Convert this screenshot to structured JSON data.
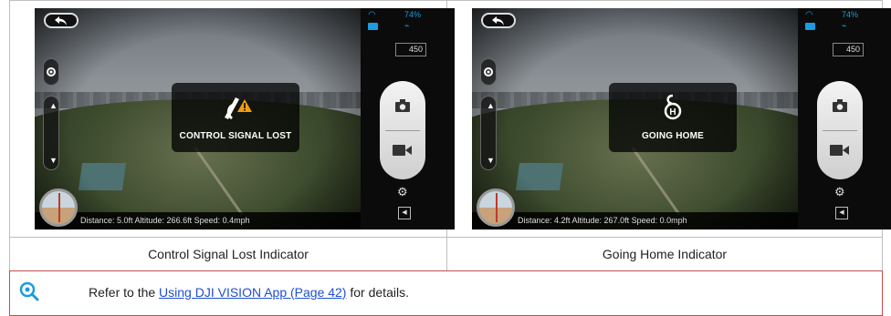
{
  "panels": [
    {
      "overlay_label": "CONTROL SIGNAL LOST",
      "overlay_icon": "signal-lost-warning-icon",
      "status": "Distance: 5.0ft  Altitude: 266.6ft  Speed: 0.4mph",
      "altitude_box": "450",
      "battery": "74%",
      "caption": "Control Signal Lost Indicator"
    },
    {
      "overlay_label": "GOING HOME",
      "overlay_icon": "home-point-icon",
      "status": "Distance: 4.2ft  Altitude: 267.0ft  Speed: 0.0mph",
      "altitude_box": "450",
      "battery": "74%",
      "caption": "Going Home Indicator"
    }
  ],
  "note": {
    "prefix": "Refer to the ",
    "link": "Using DJI VISION App (Page 42)",
    "suffix": " for details.",
    "icon": "magnifier-icon"
  },
  "colors": {
    "accent": "#1e9bdc",
    "note_border": "#c0504d",
    "warning": "#f39c12"
  }
}
